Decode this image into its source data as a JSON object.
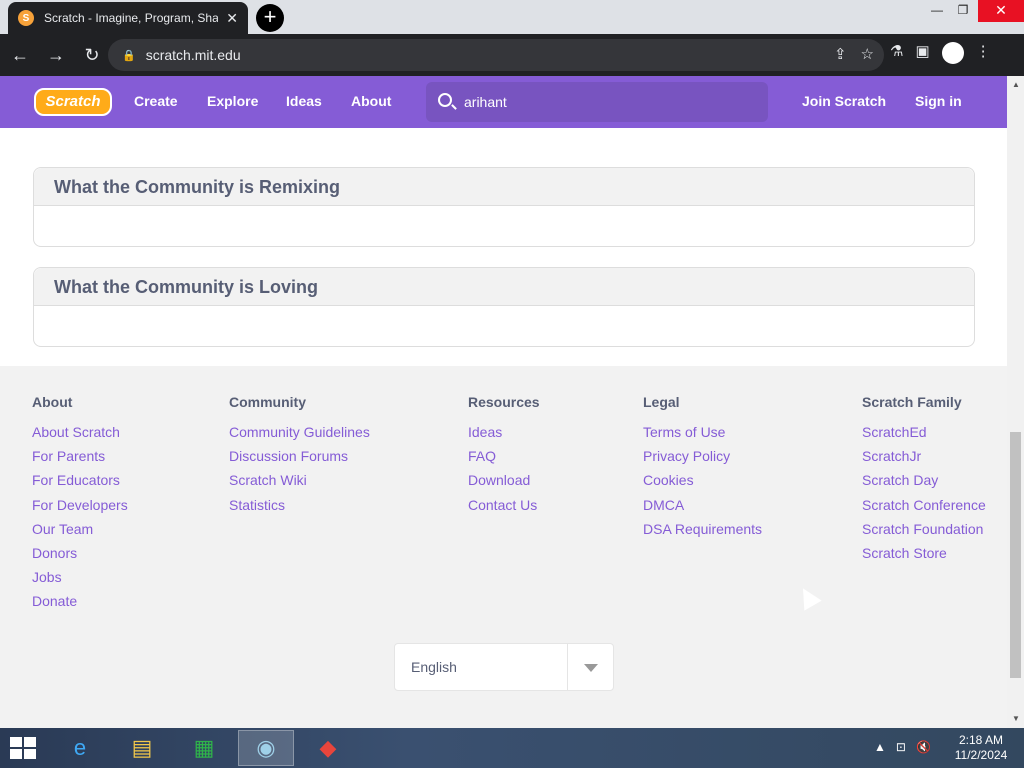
{
  "browser": {
    "tab_title": "Scratch - Imagine, Program, Sha",
    "url": "scratch.mit.edu"
  },
  "nav": {
    "logo": "Scratch",
    "links": [
      "Create",
      "Explore",
      "Ideas",
      "About"
    ],
    "search_value": "arihant",
    "join": "Join Scratch",
    "signin": "Sign in"
  },
  "sections": [
    {
      "title": "What the Community is Remixing"
    },
    {
      "title": "What the Community is Loving"
    }
  ],
  "footer": {
    "columns": [
      {
        "title": "About",
        "links": [
          "About Scratch",
          "For Parents",
          "For Educators",
          "For Developers",
          "Our Team",
          "Donors",
          "Jobs",
          "Donate"
        ]
      },
      {
        "title": "Community",
        "links": [
          "Community Guidelines",
          "Discussion Forums",
          "Scratch Wiki",
          "Statistics"
        ]
      },
      {
        "title": "Resources",
        "links": [
          "Ideas",
          "FAQ",
          "Download",
          "Contact Us"
        ]
      },
      {
        "title": "Legal",
        "links": [
          "Terms of Use",
          "Privacy Policy",
          "Cookies",
          "DMCA",
          "DSA Requirements"
        ]
      },
      {
        "title": "Scratch Family",
        "links": [
          "ScratchEd",
          "ScratchJr",
          "Scratch Day",
          "Scratch Conference",
          "Scratch Foundation",
          "Scratch Store"
        ]
      }
    ],
    "language": "English"
  },
  "taskbar": {
    "time": "2:18 AM",
    "date": "11/2/2024"
  },
  "colors": {
    "scratch_purple": "#855cd6",
    "scratch_orange": "#ffab19",
    "text_gray": "#575e75"
  }
}
